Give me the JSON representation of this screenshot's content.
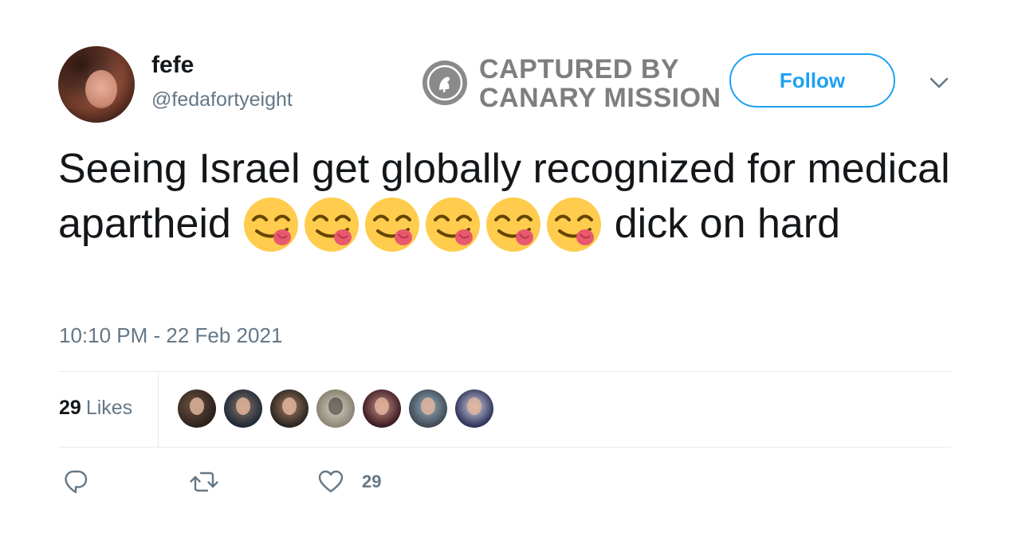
{
  "tweet": {
    "author": {
      "display_name": "fefe",
      "handle": "@fedafortyeight"
    },
    "watermark": {
      "line1": "CAPTURED BY",
      "line2": "CANARY MISSION"
    },
    "follow_label": "Follow",
    "text_before": "Seeing Israel get globally recognized for medical apartheid ",
    "emoji": [
      "😋",
      "😋",
      "😋",
      "😋",
      "😋",
      "😋"
    ],
    "text_after": " dick on hard",
    "timestamp": "10:10 PM - 22 Feb 2021",
    "stats": {
      "likes_count": "29",
      "likes_label": "Likes"
    },
    "actions": {
      "reply_icon": "reply-icon",
      "retweet_icon": "retweet-icon",
      "like_icon": "heart-icon",
      "like_count": "29"
    }
  },
  "colors": {
    "primary_text": "#14171a",
    "secondary_text": "#657786",
    "accent": "#1da1f2",
    "divider": "#e6ecf0",
    "watermark": "#7e7e7e"
  }
}
